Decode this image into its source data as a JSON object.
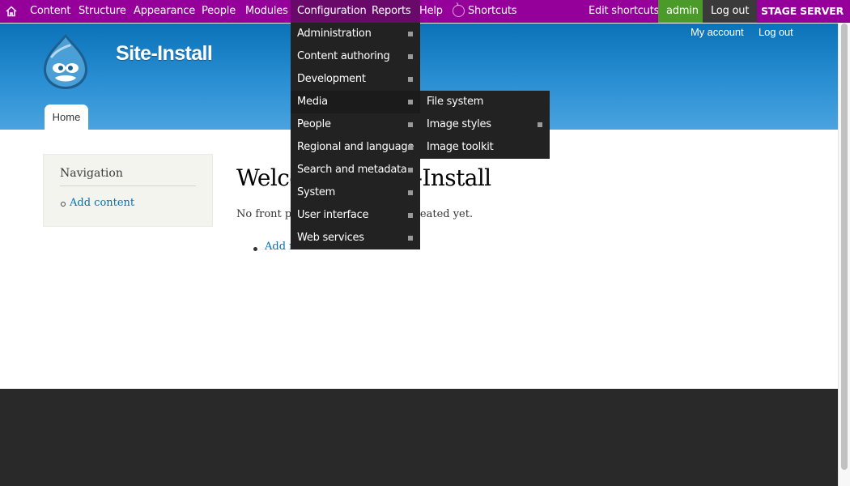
{
  "toolbar": {
    "home_icon": "home-icon",
    "items": [
      "Content",
      "Structure",
      "Appearance",
      "People",
      "Modules",
      "Configuration",
      "Reports",
      "Help"
    ],
    "shortcuts_icon": "chevron-right-circle-icon",
    "shortcuts_label": "Shortcuts",
    "edit_shortcuts": "Edit shortcuts",
    "user": "admin",
    "logout": "Log out",
    "environment": "STAGE SERVER",
    "colors": {
      "toolbar": "#96009a",
      "active": "#690a6b",
      "user": "#4b9b2b",
      "logout": "#3a3a3a"
    }
  },
  "header": {
    "logo_icon": "drupal-drop-logo",
    "site_name": "Site-Install",
    "my_account": "My account",
    "log_out": "Log out",
    "tab_home": "Home"
  },
  "sidebar": {
    "title": "Navigation",
    "link": "Add content"
  },
  "main": {
    "title": "Welcome to Site-Install",
    "message": "No front page content has been created yet.",
    "add_link": "Add new content"
  },
  "config_menu": {
    "items": [
      "Administration",
      "Content authoring",
      "Development",
      "Media",
      "People",
      "Regional and language",
      "Search and metadata",
      "System",
      "User interface",
      "Web services"
    ],
    "submenu_parent": "Media",
    "submenu": [
      "File system",
      "Image styles",
      "Image toolkit"
    ]
  }
}
